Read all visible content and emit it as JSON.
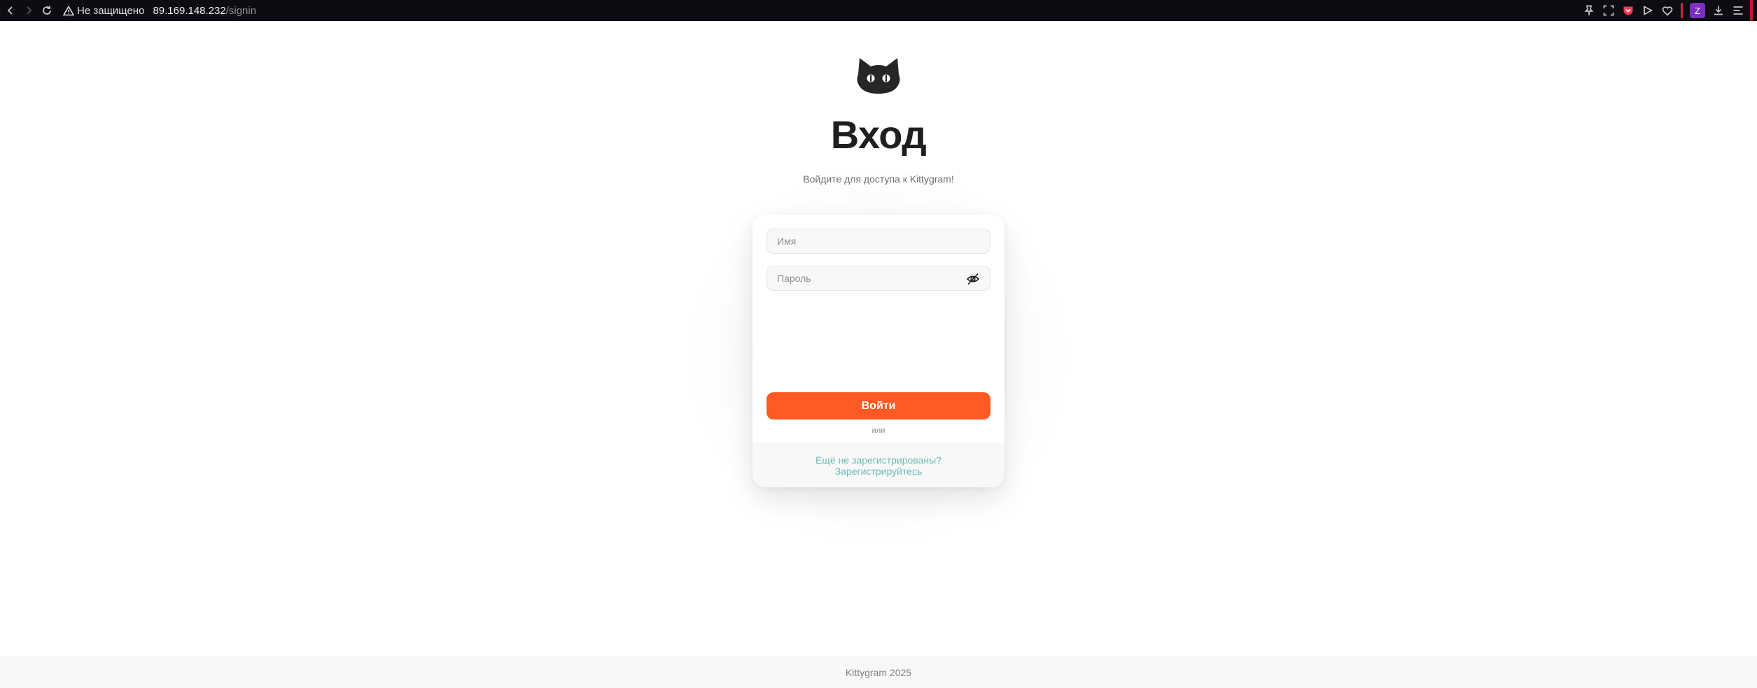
{
  "browser": {
    "security_label": "Не защищено",
    "url_host": "89.169.148.232",
    "url_path": "/signin",
    "profile_initial": "Z",
    "accent_colors": {
      "pocket": "#ef3a57",
      "profile": "#7b2fbf"
    }
  },
  "page": {
    "logo_icon": "cat-head-icon",
    "title": "Вход",
    "subtitle": "Войдите для доступа к Kittygram!"
  },
  "form": {
    "name_placeholder": "Имя",
    "password_placeholder": "Пароль",
    "submit_label": "Войти",
    "divider_label": "или",
    "register_line1": "Ещё не зарегистрированы?",
    "register_line2": "Зарегистрируйтесь",
    "colors": {
      "submit": "#ff5a24",
      "link": "#6bbcb4"
    }
  },
  "footer": {
    "text": "Kittygram 2025"
  }
}
